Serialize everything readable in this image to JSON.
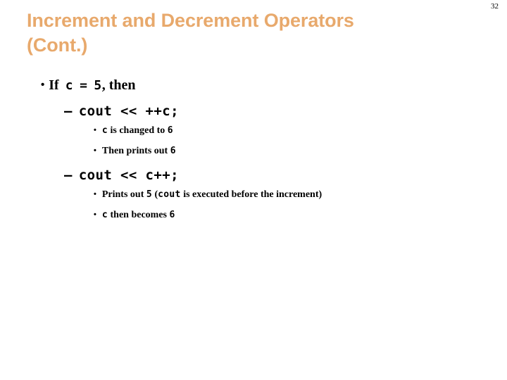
{
  "slide": {
    "page_number": "32",
    "title_line_1": "Increment and Decrement Operators",
    "title_line_2": "(Cont.)",
    "title_color": "#E8A96C",
    "background_color": "#FFFFFF",
    "text_color": "#000000"
  },
  "content": {
    "bullet_glyph": "•",
    "dash_glyph": "–",
    "item1": {
      "text_if": "If",
      "code_var": "c",
      "code_eq": "=",
      "code_val": "5",
      "text_then": ", then"
    },
    "item1_sub1": {
      "code": "cout << ++c;"
    },
    "item1_sub1_notes": [
      {
        "code_lead": "c",
        "text": " is changed to ",
        "code_trail": "6"
      },
      {
        "code_lead": "",
        "text": "Then prints out ",
        "code_trail": "6"
      }
    ],
    "item1_sub2": {
      "code": "cout << c++;"
    },
    "item1_sub2_notes": [
      {
        "text_before": "Prints out ",
        "code_a": "5",
        "text_mid": " (",
        "code_b": "cout",
        "text_after": " is executed before the increment)"
      },
      {
        "code_lead": "c",
        "text": " then becomes ",
        "code_trail": "6"
      }
    ]
  }
}
